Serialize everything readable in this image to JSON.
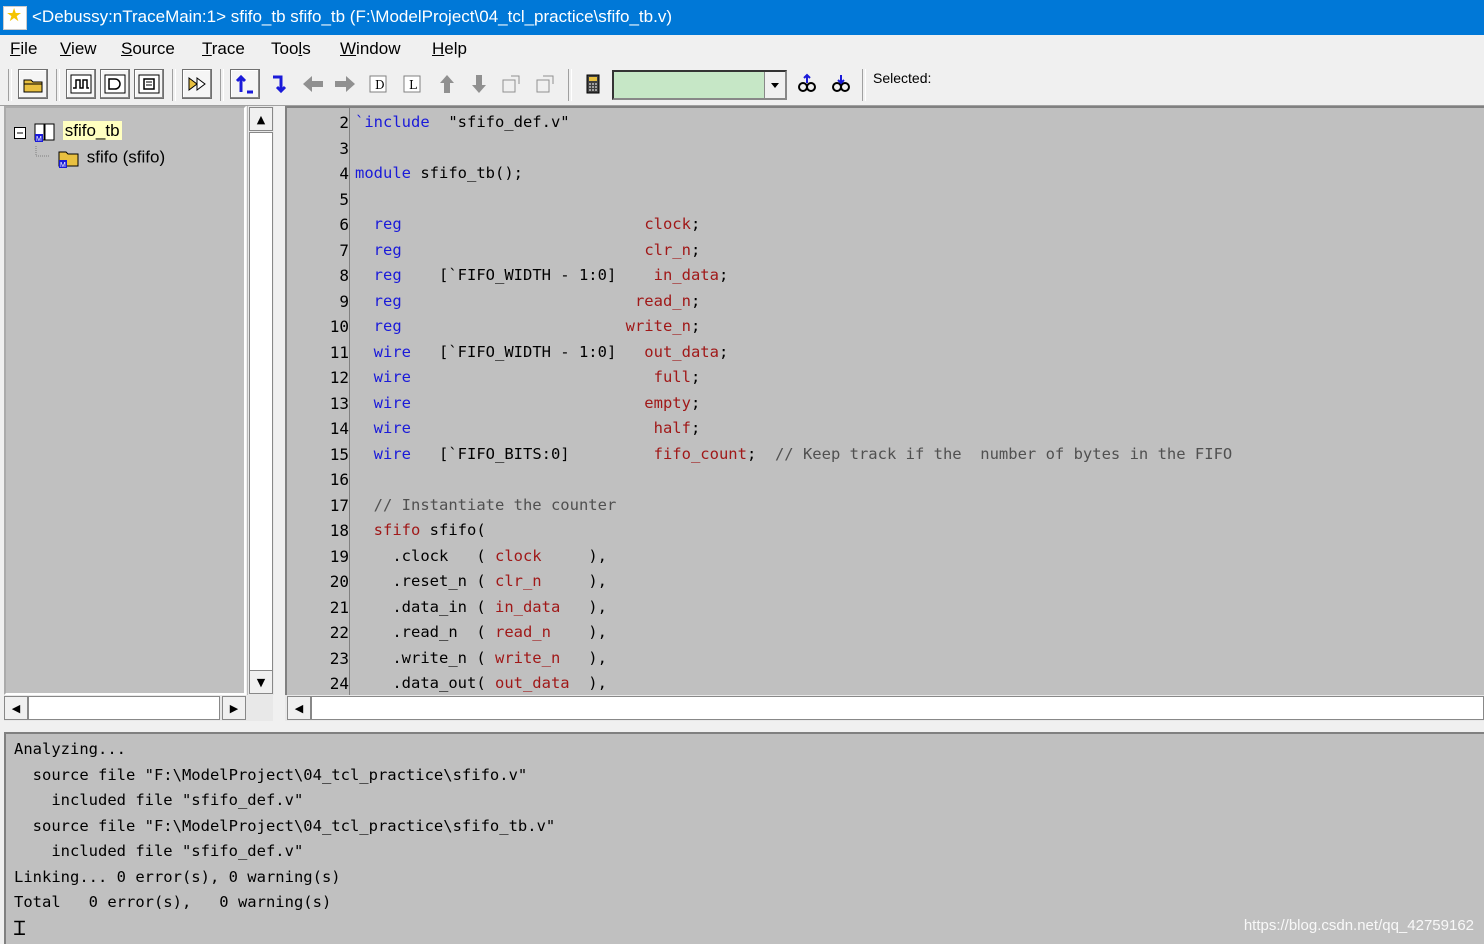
{
  "window": {
    "title": "<Debussy:nTraceMain:1> sfifo_tb sfifo_tb (F:\\ModelProject\\04_tcl_practice\\sfifo_tb.v)"
  },
  "menu": [
    {
      "label_u": "F",
      "label_rest": "ile"
    },
    {
      "label_u": "V",
      "label_rest": "iew"
    },
    {
      "label_u": "S",
      "label_rest": "ource"
    },
    {
      "label_u": "T",
      "label_rest": "race"
    },
    {
      "label_pre": "Too",
      "label_u": "l",
      "label_rest": "s"
    },
    {
      "label_u": "W",
      "label_rest": "indow"
    },
    {
      "label_u": "H",
      "label_rest": "elp"
    }
  ],
  "toolbar": {
    "selected_label": "Selected:",
    "signal_combo_value": "",
    "icons": [
      "open-icon",
      "waveform-icon",
      "schematic-icon",
      "state-icon",
      "trace-icon",
      "trace-driver-icon",
      "trace-load-icon",
      "back-icon",
      "forward-icon",
      "driver-d-icon",
      "load-l-icon",
      "up-icon",
      "down-icon",
      "prev-icon",
      "next-icon",
      "calculator-icon",
      "find-up-icon",
      "find-down-icon"
    ]
  },
  "hierarchy": {
    "root": "sfifo_tb",
    "child": "sfifo (sfifo)"
  },
  "source": {
    "lines": [
      {
        "n": "2",
        "parts": [
          [
            "kw",
            "`include"
          ],
          [
            "",
            "  \"sfifo_def.v\""
          ]
        ]
      },
      {
        "n": "3",
        "parts": []
      },
      {
        "n": "4",
        "parts": [
          [
            "kw",
            "module"
          ],
          [
            "",
            " sfifo_tb();"
          ]
        ]
      },
      {
        "n": "5",
        "parts": []
      },
      {
        "n": "6",
        "parts": [
          [
            "kw",
            "  reg"
          ],
          [
            "",
            "                          "
          ],
          [
            "id",
            "clock"
          ],
          [
            "",
            ";"
          ]
        ]
      },
      {
        "n": "7",
        "parts": [
          [
            "kw",
            "  reg"
          ],
          [
            "",
            "                          "
          ],
          [
            "id",
            "clr_n"
          ],
          [
            "",
            ";"
          ]
        ]
      },
      {
        "n": "8",
        "parts": [
          [
            "kw",
            "  reg"
          ],
          [
            "",
            "    [`FIFO_WIDTH - 1:0]    "
          ],
          [
            "id",
            "in_data"
          ],
          [
            "",
            ";"
          ]
        ]
      },
      {
        "n": "9",
        "parts": [
          [
            "kw",
            "  reg"
          ],
          [
            "",
            "                         "
          ],
          [
            "id",
            "read_n"
          ],
          [
            "",
            ";"
          ]
        ]
      },
      {
        "n": "10",
        "parts": [
          [
            "kw",
            "  reg"
          ],
          [
            "",
            "                        "
          ],
          [
            "id",
            "write_n"
          ],
          [
            "",
            ";"
          ]
        ]
      },
      {
        "n": "11",
        "parts": [
          [
            "kw",
            "  wire"
          ],
          [
            "",
            "   [`FIFO_WIDTH - 1:0]   "
          ],
          [
            "id",
            "out_data"
          ],
          [
            "",
            ";"
          ]
        ]
      },
      {
        "n": "12",
        "parts": [
          [
            "kw",
            "  wire"
          ],
          [
            "",
            "                          "
          ],
          [
            "id",
            "full"
          ],
          [
            "",
            ";"
          ]
        ]
      },
      {
        "n": "13",
        "parts": [
          [
            "kw",
            "  wire"
          ],
          [
            "",
            "                         "
          ],
          [
            "id",
            "empty"
          ],
          [
            "",
            ";"
          ]
        ]
      },
      {
        "n": "14",
        "parts": [
          [
            "kw",
            "  wire"
          ],
          [
            "",
            "                          "
          ],
          [
            "id",
            "half"
          ],
          [
            "",
            ";"
          ]
        ]
      },
      {
        "n": "15",
        "parts": [
          [
            "kw",
            "  wire"
          ],
          [
            "",
            "   [`FIFO_BITS:0]         "
          ],
          [
            "id",
            "fifo_count"
          ],
          [
            "",
            ";  "
          ],
          [
            "cm",
            "// Keep track if the  number of bytes in the FIFO"
          ]
        ]
      },
      {
        "n": "16",
        "parts": []
      },
      {
        "n": "17",
        "parts": [
          [
            "cm",
            "  // Instantiate the counter"
          ]
        ]
      },
      {
        "n": "18",
        "parts": [
          [
            "id",
            "  sfifo"
          ],
          [
            "",
            " sfifo("
          ]
        ]
      },
      {
        "n": "19",
        "parts": [
          [
            "",
            "    .clock   ( "
          ],
          [
            "id",
            "clock"
          ],
          [
            "",
            "     ),"
          ]
        ]
      },
      {
        "n": "20",
        "parts": [
          [
            "",
            "    .reset_n ( "
          ],
          [
            "id",
            "clr_n"
          ],
          [
            "",
            "     ),"
          ]
        ]
      },
      {
        "n": "21",
        "parts": [
          [
            "",
            "    .data_in ( "
          ],
          [
            "id",
            "in_data"
          ],
          [
            "",
            "   ),"
          ]
        ]
      },
      {
        "n": "22",
        "parts": [
          [
            "",
            "    .read_n  ( "
          ],
          [
            "id",
            "read_n"
          ],
          [
            "",
            "    ),"
          ]
        ]
      },
      {
        "n": "23",
        "parts": [
          [
            "",
            "    .write_n ( "
          ],
          [
            "id",
            "write_n"
          ],
          [
            "",
            "   ),"
          ]
        ]
      },
      {
        "n": "24",
        "parts": [
          [
            "",
            "    .data_out( "
          ],
          [
            "id",
            "out_data"
          ],
          [
            "",
            "  ),"
          ]
        ]
      }
    ]
  },
  "console": {
    "lines": [
      "Analyzing...",
      "  source file \"F:\\ModelProject\\04_tcl_practice\\sfifo.v\"",
      "    included file \"sfifo_def.v\"",
      "  source file \"F:\\ModelProject\\04_tcl_practice\\sfifo_tb.v\"",
      "    included file \"sfifo_def.v\"",
      "Linking... 0 error(s), 0 warning(s)",
      "Total   0 error(s),   0 warning(s)"
    ]
  },
  "watermark": "https://blog.csdn.net/qq_42759162",
  "colors": {
    "titlebar": "#0078d7",
    "keyword": "#1a1ad9",
    "identifier": "#a01818",
    "pane_bg": "#c0c0c0",
    "combo_bg": "#c6e7c6"
  }
}
